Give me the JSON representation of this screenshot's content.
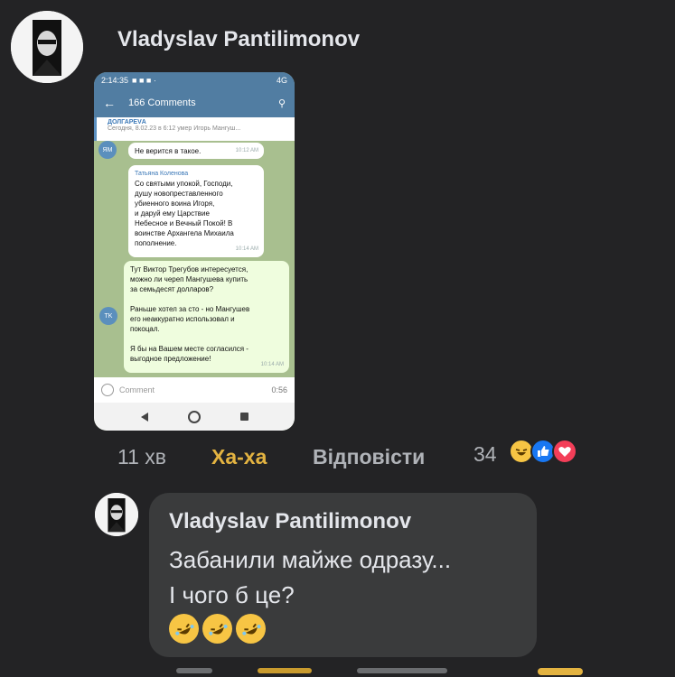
{
  "post": {
    "author": "Vladyslav Pantilimonov",
    "time": "11 хв",
    "haha_label": "Ха-ха",
    "reply_label": "Відповісти",
    "reaction_count": "34",
    "reactions": [
      "haha-icon",
      "like-icon",
      "love-icon"
    ]
  },
  "screenshot": {
    "status_time": "2:14:35",
    "status_right": "4G",
    "title": "166 Comments",
    "pinned_title": "ДОЛГАРЕVА",
    "pinned_text": "Сегодня, 8.02.23 в 6:12 умер Игорь Мангуш...",
    "msg1_avatar": "ЯМ",
    "msg1_text": "Не верится в такое.",
    "msg1_time": "10:12 AM",
    "msg2_avatar": "TK",
    "msg2_name": "Татьяна Коленова",
    "msg2_lines": [
      "Со святыми упокой, Господи,",
      "душу новопреставленного",
      "убиенного воина Игоря,",
      "и даруй ему Царствие",
      "Небесное и Вечный Покой! В",
      "воинстве Архангела Михаила",
      "пополнение."
    ],
    "msg2_time": "10:14 AM",
    "msg3_lines": [
      "Тут Виктор Трегубов интересуется,",
      "можно ли череп Мангушева купить",
      "за семьдесят долларов?",
      "",
      "Раньше хотел за  сто - но Мангушев",
      "его неаккуратно использовал и",
      "покоцал.",
      "",
      "Я бы на Вашем месте согласился -",
      "выгодное предложение!"
    ],
    "msg3_time": "10:14 AM",
    "input_placeholder": "Comment",
    "input_duration": "0:56"
  },
  "reply": {
    "author": "Vladyslav Pantilimonov",
    "line1": "Забанили майже одразу...",
    "line2": "І чого б це?",
    "emojis": [
      "rolling-laughing-icon",
      "rolling-laughing-icon",
      "rolling-laughing-icon"
    ]
  },
  "colors": {
    "background": "#232325",
    "bubble": "#3a3b3c",
    "haha": "#e3b341",
    "like": "#1877f2",
    "love": "#f33e58"
  }
}
